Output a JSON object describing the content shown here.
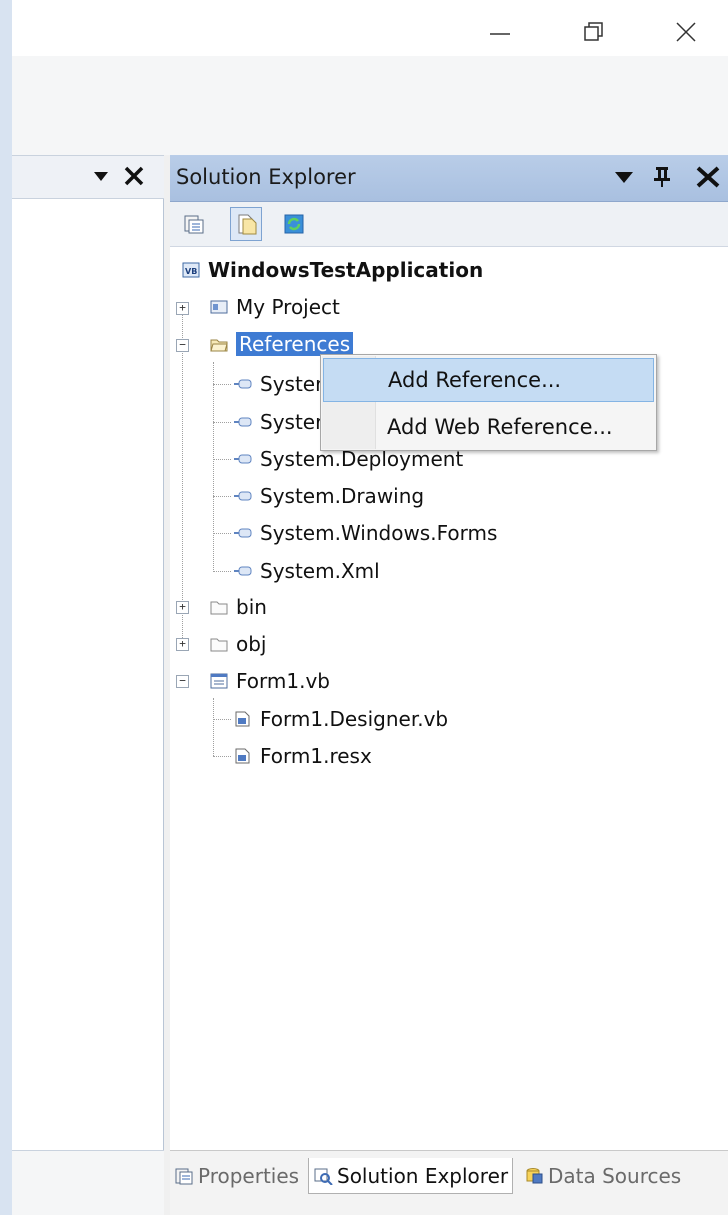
{
  "window": {
    "minimize_icon": "minimize-icon",
    "restore_icon": "restore-icon",
    "close_icon": "close-icon"
  },
  "left_panel": {
    "dropdown_icon": "triangle-down-icon",
    "close_icon": "close-icon"
  },
  "solution_explorer": {
    "title": "Solution Explorer",
    "header_icons": [
      "triangle-down-icon",
      "pin-icon",
      "close-icon"
    ],
    "toolbar": [
      {
        "icon": "properties-icon",
        "pressed": false
      },
      {
        "icon": "show-all-files-icon",
        "pressed": true
      },
      {
        "icon": "refresh-icon",
        "pressed": false
      }
    ],
    "tree": {
      "root": "WindowsTestApplication",
      "my_project": "My Project",
      "references": "References",
      "ref_1": "Syster",
      "ref_2": "Syster",
      "ref_3": "System.Deployment",
      "ref_4": "System.Drawing",
      "ref_5": "System.Windows.Forms",
      "ref_6": "System.Xml",
      "bin": "bin",
      "obj": "obj",
      "form1": "Form1.vb",
      "form1_designer": "Form1.Designer.vb",
      "form1_resx": "Form1.resx"
    },
    "context_menu": {
      "add_reference": "Add Reference...",
      "add_web_reference": "Add Web Reference..."
    },
    "tabs": {
      "properties": "Properties",
      "solution_explorer": "Solution Explorer",
      "data_sources": "Data Sources"
    }
  },
  "colors": {
    "selection": "#3e7bd3",
    "header": "#b9cde8",
    "menu_hover": "#c5dcf3"
  }
}
